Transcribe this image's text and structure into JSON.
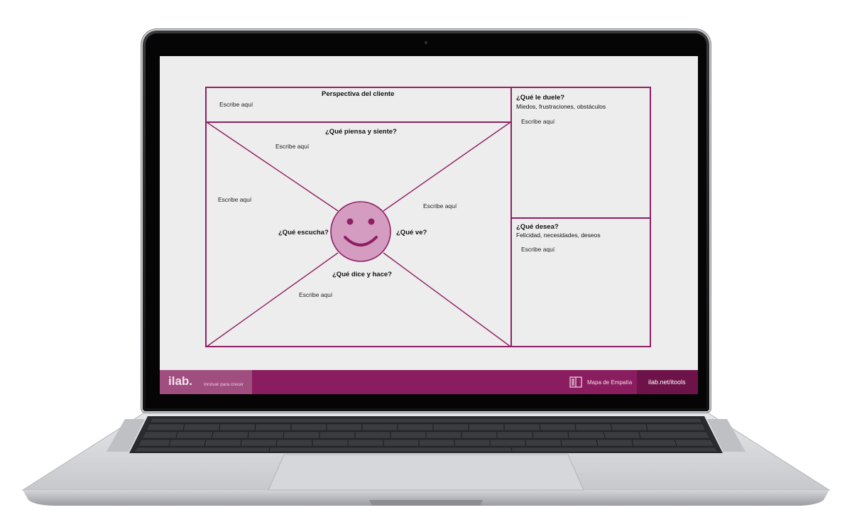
{
  "map": {
    "perspective_title": "Perspectiva del cliente",
    "placeholder": "Escribe aquí",
    "thinks_title": "¿Qué piensa y siente?",
    "hears_title": "¿Qué escucha?",
    "sees_title": "¿Qué ve?",
    "says_title": "¿Qué dice y hace?",
    "pains_title": "¿Qué le duele?",
    "pains_sub": "Miedos, frustraciones, obstáculos",
    "gains_title": "¿Qué desea?",
    "gains_sub": "Felicidad, necesidades, deseos"
  },
  "footer": {
    "logo": "ilab.",
    "tagline": "innovar para crecer",
    "map_name": "Mapa de Empatía",
    "url": "ilab.net/itools"
  },
  "colors": {
    "accent": "#8f1f63",
    "bar": "#8a1d5f",
    "face": "#d49cc1",
    "screen_bg": "#ededed"
  }
}
